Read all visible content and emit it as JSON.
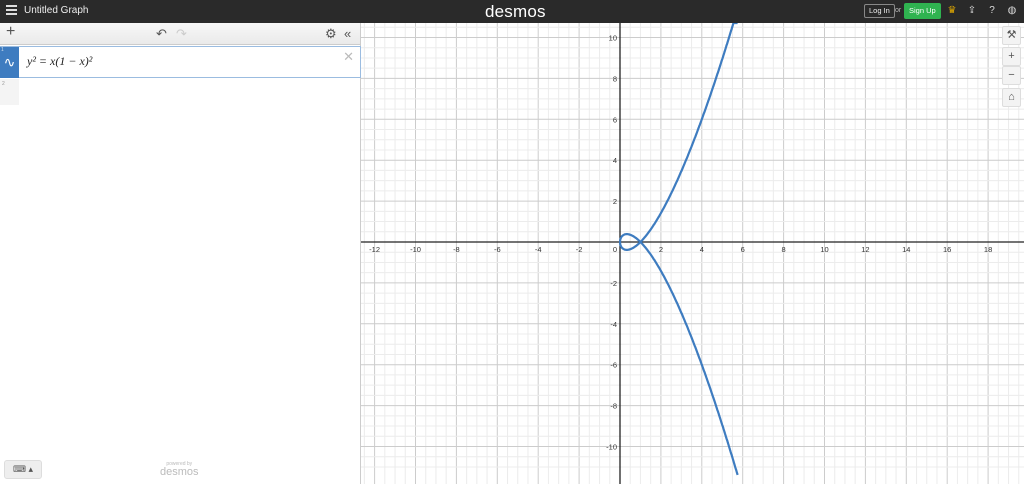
{
  "header": {
    "title": "Untitled Graph",
    "logo": "desmos",
    "login": "Log In",
    "or": "or",
    "signup": "Sign Up",
    "icons": [
      "trophy-icon",
      "share-icon",
      "help-icon",
      "globe-icon"
    ]
  },
  "expressions": [
    {
      "index": "1",
      "latex_display": "y² = x(1 − x)²",
      "color": "#3e7cc0"
    },
    {
      "index": "2"
    }
  ],
  "footer": {
    "powered": "powered by",
    "brand": "desmos"
  },
  "graph": {
    "x_ticks": [
      -12,
      -10,
      -8,
      -6,
      -4,
      -2,
      2,
      4,
      6,
      8,
      10,
      12,
      14,
      16,
      18
    ],
    "y_ticks": [
      -10,
      -8,
      -6,
      -4,
      -2,
      2,
      4,
      6,
      8,
      10
    ],
    "origin_label": "0",
    "curve_color": "#3e7cc0",
    "equation": "y^2 = x(1-x)^2"
  }
}
